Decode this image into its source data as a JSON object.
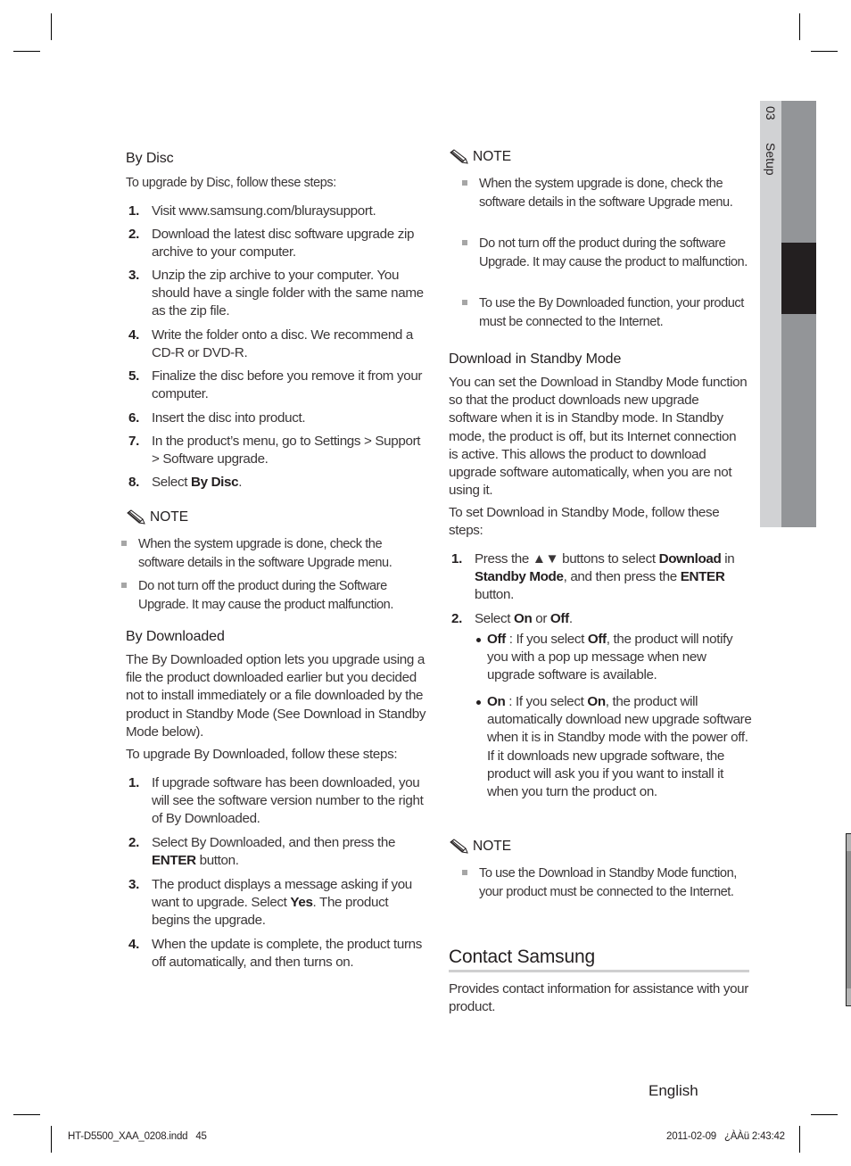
{
  "sidebar": {
    "chapter_number": "03",
    "chapter_title": "Setup"
  },
  "left_column": {
    "by_disc": {
      "heading": "By Disc",
      "intro": "To upgrade by Disc, follow these steps:",
      "steps": [
        {
          "num": "1.",
          "text": "Visit www.samsung.com/bluraysupport."
        },
        {
          "num": "2.",
          "text": "Download the latest disc software upgrade zip archive to your computer."
        },
        {
          "num": "3.",
          "text": "Unzip the zip archive to your computer. You should have a single folder with the same name as the zip file."
        },
        {
          "num": "4.",
          "text": "Write the folder onto a disc. We recommend a CD-R or DVD-R."
        },
        {
          "num": "5.",
          "text": "Finalize the disc before you remove it from your computer."
        },
        {
          "num": "6.",
          "text": "Insert the disc into product."
        },
        {
          "num": "7.",
          "text": "In the product’s menu, go to Settings > Support > Software upgrade."
        },
        {
          "num": "8.",
          "text_prefix": "Select ",
          "text_bold": "By Disc",
          "text_suffix": "."
        }
      ],
      "note": {
        "label": "NOTE",
        "items": [
          "When the system upgrade is done, check the software details in the software Upgrade menu.",
          "Do not turn off the product during the Software Upgrade. It may cause the product malfunction."
        ]
      }
    },
    "by_downloaded": {
      "heading": "By Downloaded",
      "intro": "The By Downloaded option lets you upgrade using a file the product downloaded earlier but you decided not to install immediately or a file downloaded by the product in Standby Mode (See Download in Standby Mode below).",
      "intro2": "To upgrade By Downloaded, follow these steps:",
      "steps": [
        {
          "num": "1.",
          "text": "If upgrade software has been downloaded, you will see the software version number to the right of By Downloaded."
        },
        {
          "num": "2.",
          "text_prefix": "Select By Downloaded, and then press the ",
          "text_bold": "ENTER",
          "text_suffix": " button."
        },
        {
          "num": "3.",
          "text_prefix": "The product displays a message asking if you want to upgrade. Select ",
          "text_bold": "Yes",
          "text_suffix": ". The product begins the upgrade."
        },
        {
          "num": "4.",
          "text": "When the update is complete, the product turns off automatically, and then turns on."
        }
      ]
    }
  },
  "right_column": {
    "note_top": {
      "label": "NOTE",
      "items": [
        "When the system upgrade is done, check the software details in the software Upgrade menu.",
        "Do not turn off the product during the software Upgrade. It may cause the product to malfunction.",
        "To use the By Downloaded function, your product must be connected to the Internet."
      ]
    },
    "standby": {
      "heading": "Download in Standby Mode",
      "intro": "You can set the Download in Standby Mode function so that the product downloads new upgrade software when it is in Standby mode. In Standby mode, the product is off, but its Internet connection is active. This allows the product to download upgrade software automatically, when you are not using it.",
      "intro2": "To set Download in Standby Mode, follow these steps:",
      "step1": {
        "num": "1.",
        "a": "Press the ▲▼ buttons to select ",
        "b": "Download",
        "c": " in ",
        "d": "Standby Mode",
        "e": ", and then press the ",
        "f": "ENTER",
        "g": " button."
      },
      "step2": {
        "num": "2.",
        "a": "Select ",
        "b": "On",
        "c": " or ",
        "d": "Off",
        "e": "."
      },
      "options": [
        {
          "label": "Off",
          "sep": " : If you select ",
          "label2": "Off",
          "text": ", the product will notify you with a pop up message when new upgrade software is available."
        },
        {
          "label": "On",
          "sep": " : If you select ",
          "label2": "On",
          "text": ", the product will automatically download new upgrade software when it is in Standby mode with the power off. If it downloads new upgrade software, the product will ask you if you want to install it when you turn the product on."
        }
      ],
      "note": {
        "label": "NOTE",
        "items": [
          "To use the Download in Standby Mode function, your product must be connected to the Internet."
        ]
      }
    },
    "contact": {
      "heading": "Contact Samsung",
      "text": "Provides contact information for assistance with your product."
    }
  },
  "footer": {
    "language": "English",
    "slug_file": "HT-D5500_XAA_0208.indd   45",
    "slug_date": "2011-02-09   ¿ÀÀü 2:43:42"
  }
}
